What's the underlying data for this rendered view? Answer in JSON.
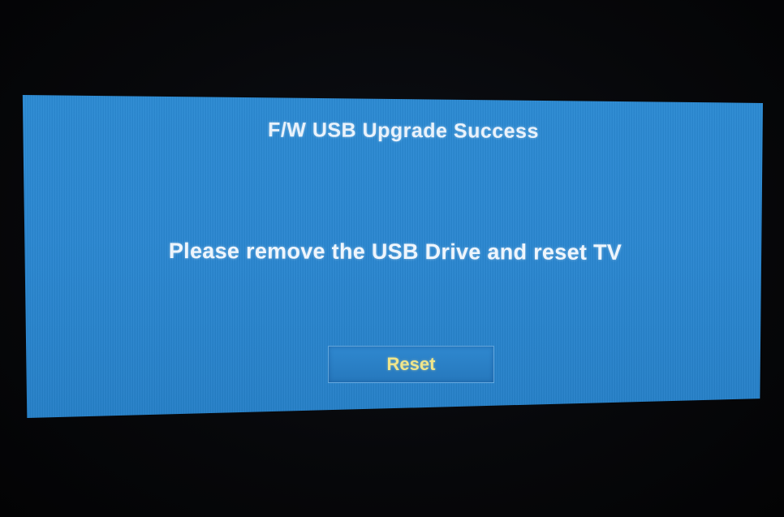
{
  "dialog": {
    "title": "F/W USB Upgrade Success",
    "message": "Please remove the USB Drive and reset TV",
    "reset_button_label": "Reset"
  },
  "colors": {
    "dialog_background": "#2a87d1",
    "text": "#eef5fc",
    "button_text": "#f0e58a",
    "screen_background": "#06070a"
  }
}
